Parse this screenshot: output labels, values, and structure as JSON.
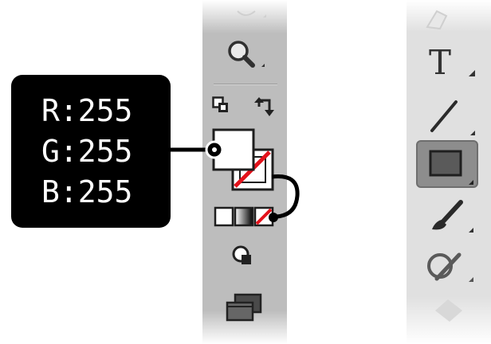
{
  "rgb_readout": {
    "channels": [
      {
        "label": "R",
        "separator": ":",
        "value": "255"
      },
      {
        "label": "G",
        "separator": ":",
        "value": "255"
      },
      {
        "label": "B",
        "separator": ":",
        "value": "255"
      }
    ]
  },
  "left_toolbar": {
    "tools": [
      "eraser-icon",
      "zoom-tool-icon",
      "default-colors-icon",
      "swap-colors-icon",
      "fill-swatch",
      "stroke-swatch-none",
      "color-mode-buttons",
      "draw-mode-icon",
      "screen-mode-icon"
    ],
    "fill_color": "#ffffff",
    "stroke_color": "none"
  },
  "right_toolbar": {
    "tools": [
      "pen-tool-icon",
      "type-tool-icon",
      "line-tool-icon",
      "rectangle-tool-icon",
      "paintbrush-tool-icon",
      "shaper-tool-icon",
      "eraser-tool-icon"
    ],
    "type_tool_glyph": "T",
    "selected_tool": "rectangle-tool-icon"
  },
  "colors": {
    "callout_bg": "#000000",
    "callout_text": "#ffffff",
    "none_slash": "#e3121b",
    "panel_left": "#bdbdbd",
    "panel_right": "#e0e0e0"
  }
}
